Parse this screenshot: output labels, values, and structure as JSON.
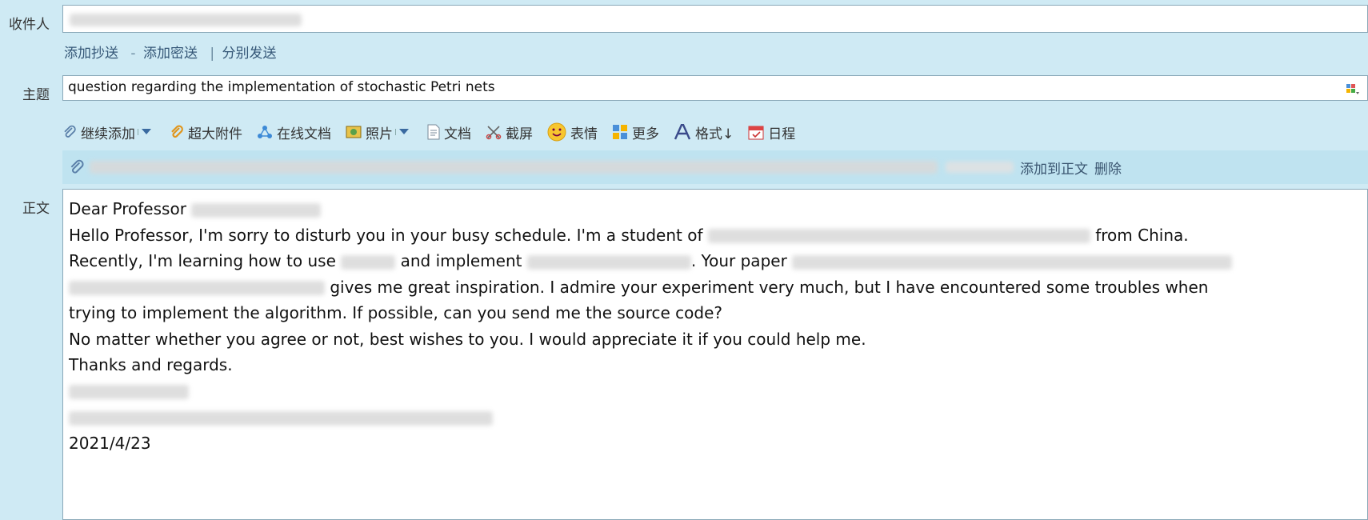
{
  "header": {
    "to_label": "收件人",
    "subject_label": "主题",
    "body_label": "正文"
  },
  "cc_links": {
    "add_cc": "添加抄送",
    "dash": "-",
    "add_bcc": "添加密送",
    "pipe": "|",
    "separate_send": "分别发送"
  },
  "subject": {
    "value": "question regarding the implementation of stochastic Petri nets"
  },
  "toolbar": {
    "continue_add": "继续添加",
    "large_attachment": "超大附件",
    "online_doc": "在线文档",
    "photo": "照片",
    "document": "文档",
    "screenshot": "截屏",
    "emoji": "表情",
    "more": "更多",
    "format": "格式↓",
    "schedule": "日程"
  },
  "attachment": {
    "add_to_body": "添加到正文",
    "delete": "删除"
  },
  "body": {
    "salutation": "Dear Professor",
    "l2_a": "Hello Professor, I'm sorry to disturb you in your busy schedule. I'm a student of ",
    "l2_b": " from China.",
    "l3_a": "Recently, I'm learning how to use ",
    "l3_b": " and implement ",
    "l3_c": ". Your paper ",
    "l4_a": " gives me great inspiration. I admire your experiment very much, but I have encountered some troubles when",
    "l5": "trying to implement the algorithm. If possible, can you send me the source code?",
    "l6": "No matter whether you agree or not, best wishes to you. I would appreciate it if you could help me.",
    "l7": "Thanks and regards.",
    "date": "2021/4/23"
  },
  "colors": {
    "background": "#cfeaf4",
    "attachment_bar": "#bfe3f0",
    "link": "#355777"
  }
}
